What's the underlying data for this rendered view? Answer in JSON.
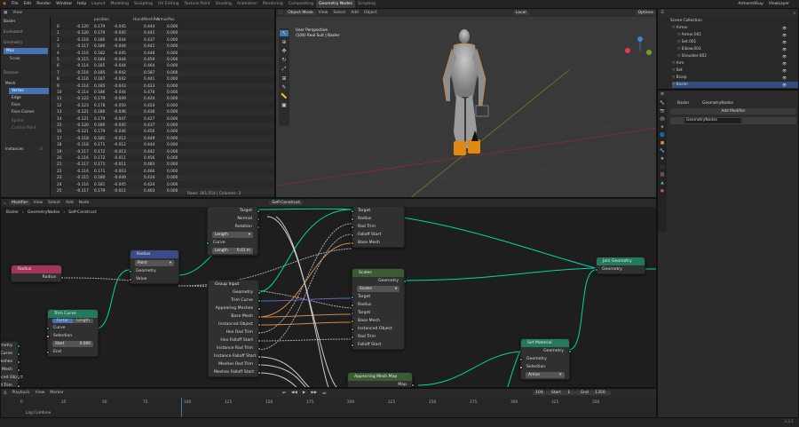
{
  "topbar": {
    "menus": [
      "File",
      "Edit",
      "Render",
      "Window",
      "Help"
    ],
    "workspaces": [
      "Layout",
      "Modeling",
      "Sculpting",
      "UV Editing",
      "Texture Paint",
      "Shading",
      "Animation",
      "Rendering",
      "Compositing",
      "Geometry Nodes",
      "Scripting"
    ],
    "active_workspace": "Geometry Nodes",
    "scene": "ArmoredGuy",
    "view_layer": "ViewLayer"
  },
  "spreadsheet": {
    "header": [
      "View"
    ],
    "object": "Basler",
    "evaluated": "Evaluated",
    "geometry_label": "Geometry",
    "items": [
      "Max",
      "Scale"
    ],
    "domain_label": "Domain",
    "domain_items": [
      "Mesh",
      "Vertex",
      "Edge",
      "Face",
      "Face Corner",
      "Spline",
      "Control Point",
      "Instances"
    ],
    "instances_count": "0",
    "vertex_count": "361554",
    "columns": [
      "position",
      "HandMeshPos",
      "ArmorPos"
    ],
    "rows": [
      [
        "0",
        "-0.120",
        "0.179",
        "-0.045",
        "0.444",
        "0.000"
      ],
      [
        "1",
        "-0.120",
        "0.179",
        "-0.045",
        "0.441",
        "0.000"
      ],
      [
        "2",
        "-0.118",
        "0.180",
        "-0.044",
        "0.437",
        "0.000"
      ],
      [
        "3",
        "-0.117",
        "0.180",
        "-0.044",
        "0.441",
        "0.000"
      ],
      [
        "4",
        "-0.116",
        "0.182",
        "-0.045",
        "0.448",
        "0.000"
      ],
      [
        "5",
        "-0.115",
        "0.184",
        "-0.044",
        "0.459",
        "0.000"
      ],
      [
        "6",
        "-0.114",
        "0.185",
        "-0.044",
        "0.464",
        "0.000"
      ],
      [
        "7",
        "-0.116",
        "0.185",
        "-0.042",
        "0.587",
        "0.000"
      ],
      [
        "8",
        "-0.116",
        "0.187",
        "-0.042",
        "0.441",
        "0.000"
      ],
      [
        "9",
        "-0.114",
        "0.185",
        "-0.043",
        "0.423",
        "0.000"
      ],
      [
        "10",
        "-0.114",
        "0.186",
        "-0.044",
        "0.476",
        "0.000"
      ],
      [
        "11",
        "-0.122",
        "0.179",
        "-0.049",
        "0.424",
        "0.000"
      ],
      [
        "12",
        "-0.123",
        "0.178",
        "-0.050",
        "0.454",
        "0.000"
      ],
      [
        "13",
        "-0.121",
        "0.180",
        "-0.046",
        "0.436",
        "0.000"
      ],
      [
        "14",
        "-0.121",
        "0.179",
        "-0.047",
        "0.427",
        "0.000"
      ],
      [
        "15",
        "-0.120",
        "0.180",
        "-0.045",
        "0.437",
        "0.000"
      ],
      [
        "16",
        "-0.121",
        "0.179",
        "-0.046",
        "0.456",
        "0.000"
      ],
      [
        "17",
        "-0.118",
        "0.181",
        "-0.012",
        "0.449",
        "0.000"
      ],
      [
        "18",
        "-0.118",
        "0.171",
        "-0.012",
        "0.444",
        "0.000"
      ],
      [
        "19",
        "-0.117",
        "0.172",
        "-0.013",
        "0.442",
        "0.000"
      ],
      [
        "20",
        "-0.116",
        "0.172",
        "-0.011",
        "0.456",
        "0.000"
      ],
      [
        "21",
        "-0.117",
        "0.171",
        "-0.011",
        "0.483",
        "0.000"
      ],
      [
        "22",
        "-0.116",
        "0.171",
        "-0.003",
        "0.466",
        "0.000"
      ],
      [
        "23",
        "-0.115",
        "0.180",
        "-0.049",
        "0.434",
        "0.000"
      ],
      [
        "24",
        "-0.116",
        "0.181",
        "-0.045",
        "0.424",
        "0.000"
      ],
      [
        "25",
        "-0.117",
        "0.179",
        "-0.011",
        "0.403",
        "0.000"
      ]
    ],
    "footer": "Rows: 361,554 | Columns: 3"
  },
  "viewport": {
    "mode": "Object Mode",
    "menus": [
      "View",
      "Select",
      "Add",
      "Object"
    ],
    "transform": "Local",
    "info_line1": "User Perspective",
    "info_line2": "(104) Real Suit | Basler",
    "options": "Options"
  },
  "outliner": {
    "title": "Scene Collection",
    "items": [
      {
        "name": "Armor",
        "indent": 1
      },
      {
        "name": "Armor.001",
        "indent": 2
      },
      {
        "name": "Set.001",
        "indent": 2
      },
      {
        "name": "Elbow.003",
        "indent": 2
      },
      {
        "name": "Shoulder.002",
        "indent": 2
      },
      {
        "name": "Arm",
        "indent": 1
      },
      {
        "name": "Set",
        "indent": 1
      },
      {
        "name": "Bicep",
        "indent": 1
      },
      {
        "name": "Basler",
        "indent": 1
      }
    ]
  },
  "properties": {
    "object": "Basler",
    "modifier_tab": "GeometryNodes",
    "add_modifier": "Add Modifier",
    "modifier_name": "GeometryNodes"
  },
  "node_editor": {
    "header": [
      "Modifier",
      "View",
      "Select",
      "Add",
      "Node"
    ],
    "tree_name": "Self-Construct",
    "breadcrumb": [
      "Basler",
      "GeometryNodes",
      "Self-Construct"
    ],
    "nodes": {
      "radius_in": {
        "title": "Radius",
        "out": "Radius"
      },
      "radius": {
        "title": "Radius",
        "dropdown": "Point",
        "in": "Geometry",
        "out": "Value"
      },
      "trim": {
        "title": "Trim Curve",
        "tabs": [
          "Factor",
          "Length"
        ],
        "out": "Curve",
        "selection": "Selection",
        "start_label": "Start",
        "start_val": "0.000",
        "end": "End",
        "in": "Curve"
      },
      "length_node": {
        "dropdown": "Length",
        "in": "Curve",
        "field_label": "Length",
        "field_val": "0.01 m",
        "sockets": [
          "Target",
          "Normal",
          "Rotation"
        ]
      },
      "group_input": {
        "title": "Group Input",
        "outs": [
          "Geometry",
          "Trim Curve",
          "Appearing Meshes",
          "Base Mesh",
          "Instanced Object",
          "Hex Rad Trim",
          "Hex Falloff Start",
          "Instance Rad Trim",
          "Instance Falloff Start",
          "Meshes Rad Trim",
          "Meshes Falloff Start"
        ]
      },
      "upper": {
        "sockets": [
          "Target",
          "Radius",
          "Rad Trim",
          "Falloff Start",
          "Base Mesh"
        ]
      },
      "scales": {
        "title": "Scales",
        "out": "Geometry",
        "dropdown": "Scales",
        "ins": [
          "Target",
          "Radius",
          "Target",
          "Base Mesh",
          "Instanced Object",
          "Rad Trim",
          "Falloff Start"
        ]
      },
      "join": {
        "title": "Join Geometry",
        "in": "Geometry"
      },
      "set_material": {
        "title": "Set Material",
        "out": "Geometry",
        "ins": [
          "Geometry",
          "Selection"
        ],
        "material": "Armor"
      },
      "appearing": {
        "title": "Appearing Mesh Map",
        "out": "Map"
      },
      "left_partial": [
        "Geometry",
        "Trim Curve",
        "Meshes",
        "Base Mesh",
        "Instanced Object",
        "Rad Trim"
      ]
    }
  },
  "timeline": {
    "menus": [
      "Playback",
      "View",
      "Marker"
    ],
    "frame": "104",
    "start_label": "Start",
    "start": "1",
    "end_label": "End",
    "end": "1350",
    "ticks": [
      "0",
      "25",
      "50",
      "75",
      "100",
      "125",
      "150",
      "175",
      "200",
      "225",
      "250",
      "275",
      "300",
      "325",
      "350"
    ],
    "marker": "Lag Combine"
  },
  "version": "3.3.1"
}
